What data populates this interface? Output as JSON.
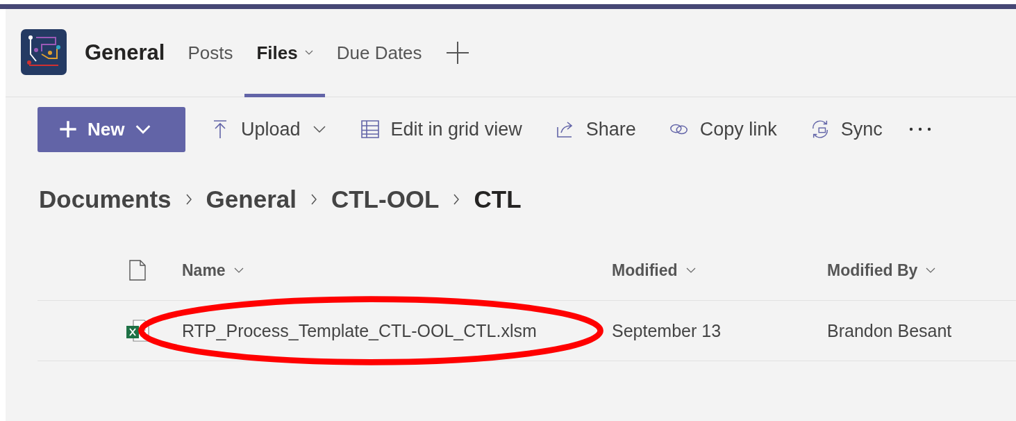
{
  "channel": {
    "name": "General"
  },
  "tabs": [
    {
      "label": "Posts",
      "selected": false,
      "dropdown": false
    },
    {
      "label": "Files",
      "selected": true,
      "dropdown": true
    },
    {
      "label": "Due Dates",
      "selected": false,
      "dropdown": false
    }
  ],
  "toolbar": [
    {
      "kind": "new",
      "label": "New",
      "dropdown": true
    },
    {
      "kind": "upload",
      "label": "Upload",
      "dropdown": true
    },
    {
      "kind": "grid",
      "label": "Edit in grid view",
      "dropdown": false
    },
    {
      "kind": "share",
      "label": "Share",
      "dropdown": false
    },
    {
      "kind": "link",
      "label": "Copy link",
      "dropdown": false
    },
    {
      "kind": "sync",
      "label": "Sync",
      "dropdown": false
    },
    {
      "kind": "more"
    }
  ],
  "breadcrumb": [
    "Documents",
    "General",
    "CTL-OOL",
    "CTL"
  ],
  "table": {
    "columns": [
      "Name",
      "Modified",
      "Modified By"
    ],
    "rows": [
      {
        "name": "RTP_Process_Template_CTL-OOL_CTL.xlsm",
        "modified": "September 13",
        "modified_by": "Brandon Besant",
        "highlighted": true
      }
    ]
  }
}
